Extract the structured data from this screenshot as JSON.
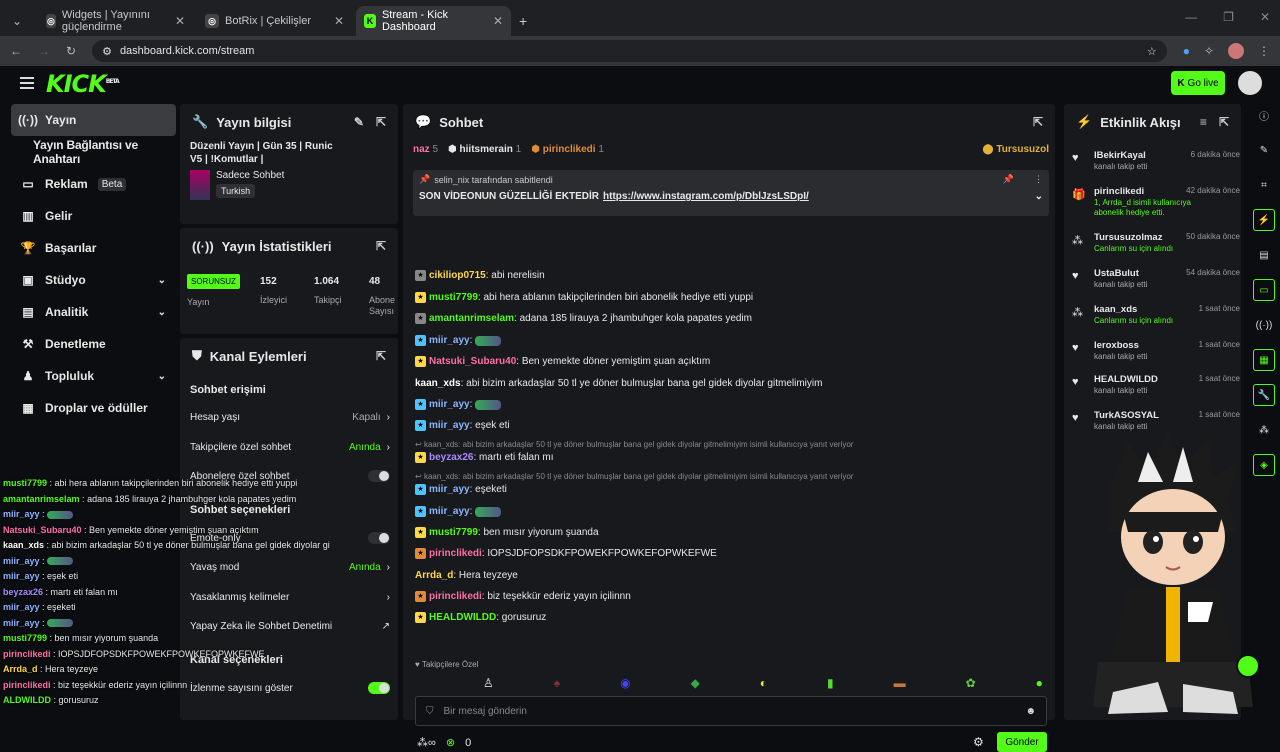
{
  "browser": {
    "tabs": [
      {
        "title": "Widgets | Yayınını güçlendirme",
        "active": false
      },
      {
        "title": "BotRix | Çekilişler",
        "active": false
      },
      {
        "title": "Stream - Kick Dashboard",
        "active": true
      }
    ],
    "url": "dashboard.kick.com/stream"
  },
  "header": {
    "logo": "KICK",
    "logo_badge": "BETA",
    "go_live": "Go live"
  },
  "nav": [
    {
      "label": "Yayın",
      "icon": "broadcast-icon",
      "active": true
    },
    {
      "label": "Yayın Bağlantısı ve Anahtarı",
      "icon": ""
    },
    {
      "label": "Reklam",
      "icon": "ad-icon",
      "badge": "Beta"
    },
    {
      "label": "Gelir",
      "icon": "chart-icon"
    },
    {
      "label": "Başarılar",
      "icon": "trophy-icon"
    },
    {
      "label": "Stüdyo",
      "icon": "studio-icon",
      "chevron": true
    },
    {
      "label": "Analitik",
      "icon": "analytics-icon",
      "chevron": true
    },
    {
      "label": "Denetleme",
      "icon": "hammer-icon"
    },
    {
      "label": "Topluluk",
      "icon": "community-icon",
      "chevron": true
    },
    {
      "label": "Droplar ve ödüller",
      "icon": "drops-icon"
    }
  ],
  "stream_info": {
    "title": "Yayın bilgisi",
    "stream_title": "Düzenli Yayın | Gün 35 | Runic V5 | !Komutlar |",
    "category": "Sadece Sohbet",
    "language": "Turkish"
  },
  "stats": {
    "title": "Yayın İstatistikleri",
    "status": "SORUNSUZ",
    "status_label": "Yayın",
    "viewers": "152",
    "viewers_label": "İzleyici",
    "followers": "1.064",
    "followers_label": "Takipçi",
    "subs": "48",
    "subs_label": "Abone Sayısı"
  },
  "channel_actions": {
    "title": "Kanal Eylemleri",
    "chat_access": "Sohbet erişimi",
    "account_age": "Hesap yaşı",
    "account_age_value": "Kapalı",
    "followers_only": "Takipçilere özel sohbet",
    "followers_only_value": "Anında",
    "subs_only": "Abonelere özel sohbet",
    "chat_options": "Sohbet seçenekleri",
    "emote_only": "Emote-only",
    "slow_mode": "Yavaş mod",
    "slow_mode_value": "Anında",
    "banned_words": "Yasaklanmış kelimeler",
    "ai_moderation": "Yapay Zeka ile Sohbet Denetimi",
    "channel_settings": "Kanal seçenekleri",
    "show_viewer_count": "İzlenme sayısını göster"
  },
  "chat": {
    "title": "Sohbet",
    "top_gifters": [
      {
        "name": "naz",
        "count": "5"
      },
      {
        "name": "hiitsmerain",
        "count": "1"
      },
      {
        "name": "pirinclikedi",
        "count": "1"
      }
    ],
    "top_right": "Tursusuzol",
    "pinned_by": "selin_nix tarafından sabitlendi",
    "pinned_text": "SON VİDEONUN GÜZELLİĞİ EKTEDİR",
    "pinned_link": "https://www.instagram.com/p/DblJzsLSDpI/",
    "messages": [
      {
        "user": "cikiliop0715",
        "text": "abi nerelisin",
        "color": "#ffd84a"
      },
      {
        "user": "musti7799",
        "text": "abi hera ablanın takipçilerinden biri abonelik hediye etti yuppi",
        "color": "#53fc18"
      },
      {
        "user": "amantanrimselam",
        "text": "adana 185 lirauya 2 jhambuhger kola papates yedim",
        "color": "#53fc18"
      },
      {
        "user": "miir_ayy",
        "text": "",
        "color": "#8cb4ff"
      },
      {
        "user": "Natsuki_Subaru40",
        "text": "Ben yemekte döner yemiştim şuan açıktım",
        "color": "#ff6fa3"
      },
      {
        "user": "kaan_xds",
        "text": "abi bizim arkadaşlar 50 tl ye döner bulmuşlar bana gel gidek diyolar gitmelimiyim",
        "color": "#ffffff"
      },
      {
        "user": "miir_ayy",
        "text": "",
        "color": "#8cb4ff"
      },
      {
        "user": "miir_ayy",
        "text": "eşek eti",
        "color": "#8cb4ff"
      },
      {
        "user": "beyzax26",
        "text": "martı eti falan mı",
        "color": "#a98bff"
      },
      {
        "user": "miir_ayy",
        "text": "eşeketi",
        "color": "#8cb4ff"
      },
      {
        "user": "miir_ayy",
        "text": "",
        "color": "#8cb4ff"
      },
      {
        "user": "musti7799",
        "text": "ben mısır yiyorum şuanda",
        "color": "#53fc18"
      },
      {
        "user": "pirinclikedi",
        "text": "IOPSJDFOPSDKFPOWEKFPOWKEFOPWKEFWE",
        "color": "#ff6fa3"
      },
      {
        "user": "Arrda_d",
        "text": "Hera teyzeye",
        "color": "#ffd84a"
      },
      {
        "user": "pirinclikedi",
        "text": "biz teşekkür ederiz yayın içilinnn",
        "color": "#ff6fa3"
      },
      {
        "user": "HEALDWILDD",
        "text": "gorusuruz",
        "color": "#53fc18"
      }
    ],
    "reply_text": "kaan_xds: abi bizim arkadaşlar 50 tl ye döner bulmuşlar bana gel gidek diyolar gitmelimiyim isimli kullanıcıya yanıt veriyor",
    "followers_only_label": "Takipçilere Özel",
    "input_placeholder": "Bir mesaj gönderin",
    "points_value": "0",
    "send": "Gönder"
  },
  "activity": {
    "title": "Etkinlik Akışı",
    "items": [
      {
        "name": "IBekirKayal",
        "time": "6 dakika önce",
        "sub": "kanalı takip etti",
        "icon": "heart-icon"
      },
      {
        "name": "pirinclikedi",
        "time": "42 dakika önce",
        "sub": "1, Arrda_d isimli kullanıcıya abonelik hediye etti.",
        "icon": "gift-icon"
      },
      {
        "name": "Tursusuzolmaz",
        "time": "50 dakika önce",
        "sub": "Canlarım su için alındı",
        "icon": "points-icon"
      },
      {
        "name": "UstaBulut",
        "time": "54 dakika önce",
        "sub": "kanalı takip etti",
        "icon": "heart-icon"
      },
      {
        "name": "kaan_xds",
        "time": "1 saat önce",
        "sub": "Canlarım su için alındı",
        "icon": "points-icon"
      },
      {
        "name": "leroxboss",
        "time": "1 saat önce",
        "sub": "kanalı takip etti",
        "icon": "heart-icon"
      },
      {
        "name": "HEALDWILDD",
        "time": "1 saat önce",
        "sub": "kanalı takip etti",
        "icon": "heart-icon"
      },
      {
        "name": "TurkASOSYAL",
        "time": "1 saat önce",
        "sub": "kanalı takip etti",
        "icon": "heart-icon"
      }
    ]
  },
  "overlay_chat": [
    {
      "user": "musti7799",
      "text": "abi hera ablanın takipçilerinden biri abonelik hediye etti yuppi"
    },
    {
      "user": "amantanrimselam",
      "text": "adana 185 lirauya 2 jhambuhger kola papates yedim"
    },
    {
      "user": "miir_ayy",
      "text": ""
    },
    {
      "user": "Natsuki_Subaru40",
      "text": "Ben yemekte döner yemiştim şuan açıktım"
    },
    {
      "user": "kaan_xds",
      "text": "abi bizim arkadaşlar 50 tl ye döner bulmuşlar bana gel gidek diyolar gitmelimiyim"
    },
    {
      "user": "miir_ayy",
      "text": ""
    },
    {
      "user": "miir_ayy",
      "text": "eşek eti"
    },
    {
      "user": "beyzax26",
      "text": "martı eti falan mı"
    },
    {
      "user": "miir_ayy",
      "text": "eşeketi"
    },
    {
      "user": "miir_ayy",
      "text": ""
    },
    {
      "user": "musti7799",
      "text": "ben mısır yiyorum şuanda"
    },
    {
      "user": "pirinclikedi",
      "text": "IOPSJDFOPSDKFPOWEKFPOWKEFOPWKEFWE"
    },
    {
      "user": "Arrda_d",
      "text": "Hera teyzeye"
    },
    {
      "user": "pirinclikedi",
      "text": "biz teşekkür ederiz yayın içilinnn"
    },
    {
      "user": "ALDWILDD",
      "text": "gorusuruz"
    }
  ],
  "colors": {
    "accent": "#53fc18",
    "panel": "#17191c",
    "bg": "#0b0d10"
  }
}
